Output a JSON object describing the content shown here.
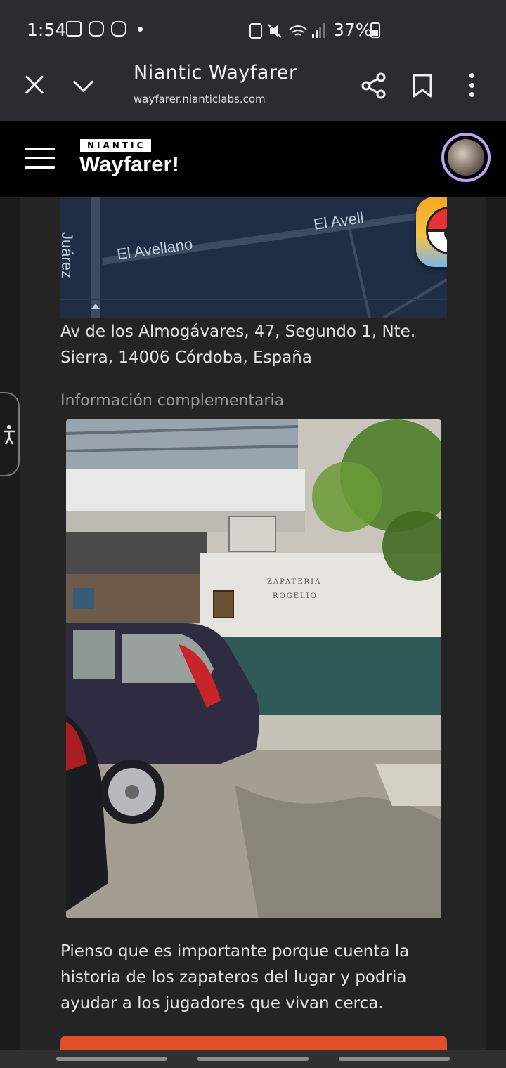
{
  "status_bar": {
    "time": "1:54",
    "battery": "37%",
    "icons": [
      "gallery-icon",
      "discord-icon",
      "discord-icon",
      "dot-icon",
      "battery-saver-icon",
      "mute-icon",
      "wifi-icon",
      "signal-icon"
    ]
  },
  "browser": {
    "title": "Niantic Wayfarer",
    "url": "wayfarer.nianticlabs.com"
  },
  "app_header": {
    "brand_small": "NIANTIC",
    "brand_large": "Wayfarer!"
  },
  "map": {
    "labels": [
      "Juárez",
      "El Avellano",
      "El Avell"
    ]
  },
  "location": {
    "address": "Av de los Almogávares, 47, Segundo 1, Nte. Sierra, 14006 Córdoba, España"
  },
  "supplemental": {
    "label": "Información complementaria",
    "photo_signage": [
      "ZAPATERIA",
      "ROGELIO"
    ],
    "description": "Pienso que es importante porque cuenta la historia de los zapateros del lugar y podria ayudar a los jugadores que vivan cerca."
  },
  "colors": {
    "accent_button": "#e1502a",
    "avatar_ring": "#b9a2f0",
    "map_bg": "#1f2d45"
  }
}
